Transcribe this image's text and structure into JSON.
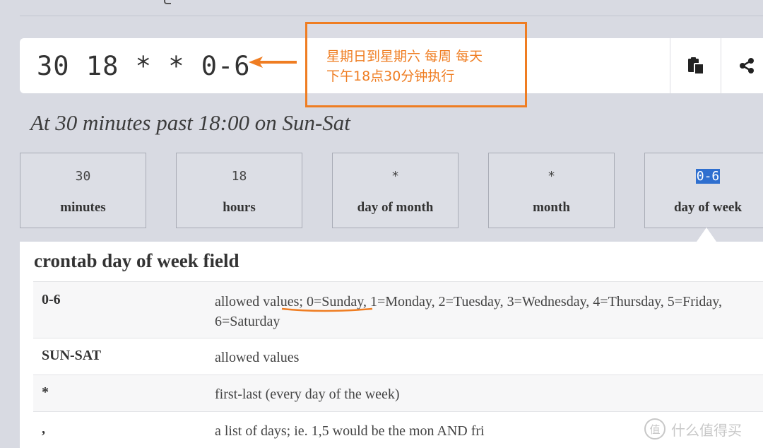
{
  "expression": {
    "text": "30 18 * * 0-6",
    "actions": [
      {
        "icon": "copy-icon"
      },
      {
        "icon": "share-icon"
      }
    ]
  },
  "annotation": {
    "line1": "星期日到星期六 每周 每天",
    "line2": "下午18点30分钟执行",
    "color": "#ef7d22"
  },
  "description": "At 30 minutes past 18:00 on Sun-Sat",
  "fields": [
    {
      "value": "30",
      "label": "minutes"
    },
    {
      "value": "18",
      "label": "hours"
    },
    {
      "value": "*",
      "label": "day of month"
    },
    {
      "value": "*",
      "label": "month"
    },
    {
      "value": "0-6",
      "label": "day of week",
      "selected": true
    }
  ],
  "panel": {
    "title": "crontab day of week field",
    "rows": [
      {
        "key": "0-6",
        "value": "allowed values; 0=Sunday, 1=Monday, 2=Tuesday, 3=Wednesday, 4=Thursday, 5=Friday, 6=Saturday"
      },
      {
        "key": "SUN-SAT",
        "value": "allowed values"
      },
      {
        "key": "*",
        "value": "first-last (every day of the week)"
      },
      {
        "key": ",",
        "value": "a list of days; ie. 1,5 would be the mon AND fri"
      }
    ]
  },
  "watermark": {
    "badge": "值",
    "text": "什么值得买"
  },
  "colors": {
    "background": "#d8dae2",
    "accent": "#ef7d22",
    "selection": "#2f6fcf"
  }
}
